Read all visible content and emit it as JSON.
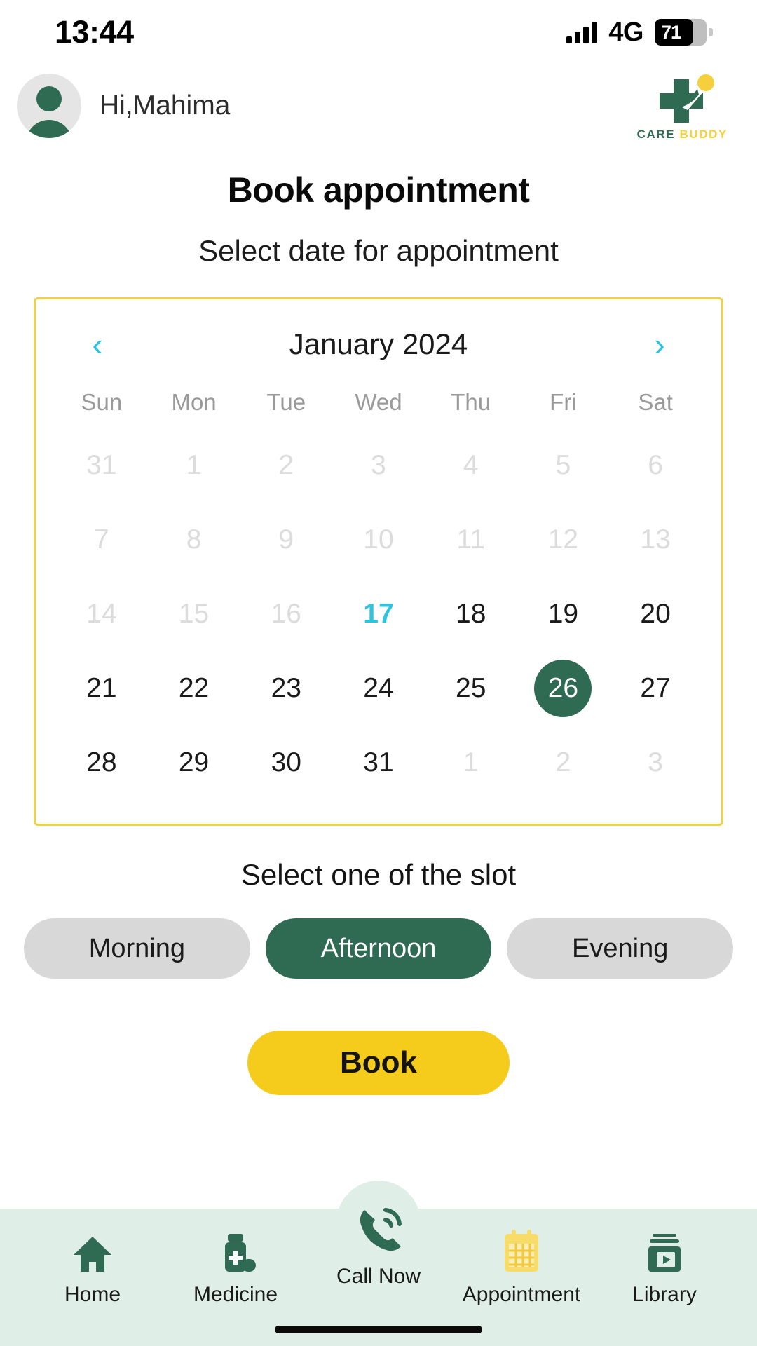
{
  "status_bar": {
    "time": "13:44",
    "network": "4G",
    "battery_percent": "71",
    "signal_icon": "signal-bars-icon",
    "battery_icon": "battery-icon"
  },
  "header": {
    "greeting": "Hi,Mahima",
    "avatar_icon": "avatar-person-icon",
    "brand_mark_icon": "care-buddy-cross-icon",
    "brand_name_part1": "CARE",
    "brand_name_part2": "BUDDY"
  },
  "page": {
    "title": "Book appointment",
    "subtitle": "Select date for appointment"
  },
  "calendar": {
    "prev_label": "‹",
    "next_label": "›",
    "month_label": "January 2024",
    "weekdays": [
      "Sun",
      "Mon",
      "Tue",
      "Wed",
      "Thu",
      "Fri",
      "Sat"
    ],
    "today": "17",
    "selected": "26",
    "border_color": "#edd14a",
    "selected_color": "#2f6b53",
    "today_color": "#2ec4dd",
    "days": [
      {
        "n": "31",
        "state": "muted"
      },
      {
        "n": "1",
        "state": "muted"
      },
      {
        "n": "2",
        "state": "muted"
      },
      {
        "n": "3",
        "state": "muted"
      },
      {
        "n": "4",
        "state": "muted"
      },
      {
        "n": "5",
        "state": "muted"
      },
      {
        "n": "6",
        "state": "muted"
      },
      {
        "n": "7",
        "state": "muted"
      },
      {
        "n": "8",
        "state": "muted"
      },
      {
        "n": "9",
        "state": "muted"
      },
      {
        "n": "10",
        "state": "muted"
      },
      {
        "n": "11",
        "state": "muted"
      },
      {
        "n": "12",
        "state": "muted"
      },
      {
        "n": "13",
        "state": "muted"
      },
      {
        "n": "14",
        "state": "muted"
      },
      {
        "n": "15",
        "state": "muted"
      },
      {
        "n": "16",
        "state": "muted"
      },
      {
        "n": "17",
        "state": "today"
      },
      {
        "n": "18",
        "state": "normal"
      },
      {
        "n": "19",
        "state": "normal"
      },
      {
        "n": "20",
        "state": "normal"
      },
      {
        "n": "21",
        "state": "normal"
      },
      {
        "n": "22",
        "state": "normal"
      },
      {
        "n": "23",
        "state": "normal"
      },
      {
        "n": "24",
        "state": "normal"
      },
      {
        "n": "25",
        "state": "normal"
      },
      {
        "n": "26",
        "state": "selected"
      },
      {
        "n": "27",
        "state": "normal"
      },
      {
        "n": "28",
        "state": "normal"
      },
      {
        "n": "29",
        "state": "normal"
      },
      {
        "n": "30",
        "state": "normal"
      },
      {
        "n": "31",
        "state": "normal"
      },
      {
        "n": "1",
        "state": "muted"
      },
      {
        "n": "2",
        "state": "muted"
      },
      {
        "n": "3",
        "state": "muted"
      }
    ]
  },
  "slots": {
    "title": "Select one of the slot",
    "options": [
      {
        "label": "Morning",
        "selected": false
      },
      {
        "label": "Afternoon",
        "selected": true
      },
      {
        "label": "Evening",
        "selected": false
      }
    ]
  },
  "primary_action": {
    "label": "Book",
    "color": "#f5cc1b"
  },
  "bottom_nav": {
    "items": [
      {
        "label": "Home",
        "icon": "home-icon",
        "active": false
      },
      {
        "label": "Medicine",
        "icon": "medicine-bottle-icon",
        "active": false
      },
      {
        "label": "Call Now",
        "icon": "phone-call-icon",
        "active": false
      },
      {
        "label": "Appointment",
        "icon": "calendar-icon",
        "active": true
      },
      {
        "label": "Library",
        "icon": "video-library-icon",
        "active": false
      }
    ]
  }
}
